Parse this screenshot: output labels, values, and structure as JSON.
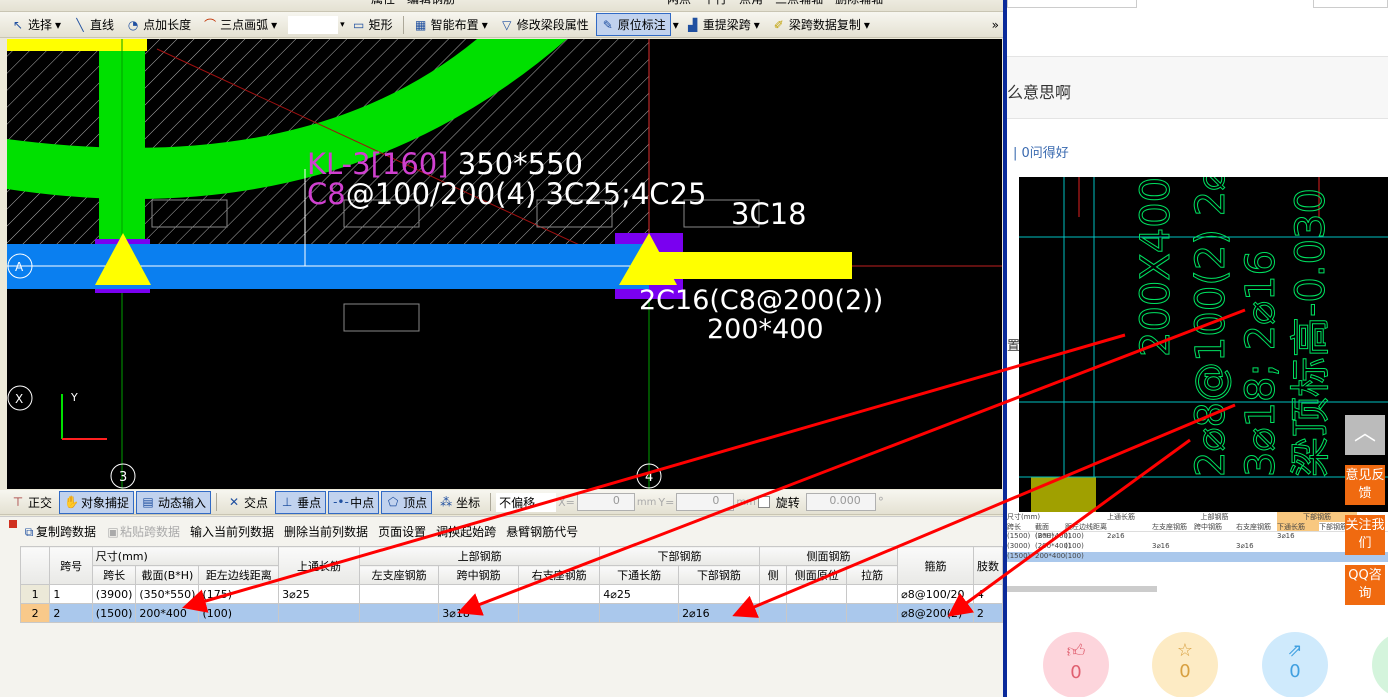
{
  "toolbar_top": {
    "items": [
      "属性",
      "编辑钢筋",
      "两点",
      "平行",
      "点角",
      "三点辅轴",
      "删除辅轴"
    ]
  },
  "toolbar": {
    "select": "选择",
    "line": "直线",
    "point_length": "点加长度",
    "arc": "三点画弧",
    "rect": "矩形",
    "smart": "智能布置",
    "modify_seg": "修改梁段属性",
    "in_situ": "原位标注",
    "repick": "重提梁跨",
    "copy_span": "梁跨数据复制",
    "more": "»"
  },
  "canvas": {
    "label1a": "KL-3[160]",
    "label1b": " 350*550",
    "label2a": "C8",
    "label2b": "@100/200(4) 3C25;4C25",
    "label3": "3C18",
    "label4": "2C16(C8@200(2))",
    "label5": "200*400",
    "axis_a": "A",
    "axis_3": "3",
    "axis_4": "4",
    "axis_x": "X",
    "axis_y": "Y"
  },
  "snapbar": {
    "ortho": "正交",
    "snap": "对象捕捉",
    "dyn": "动态输入",
    "intersect": "交点",
    "perp": "垂点",
    "mid": "中点",
    "vertex": "顶点",
    "coord": "坐标",
    "offset": "不偏移",
    "x_label": "X=",
    "x_val": "0",
    "y_label": "Y=",
    "y_val": "0",
    "mm": "mm",
    "rotate": "旋转",
    "rotate_val": "0.000",
    "deg": "°"
  },
  "panel": {
    "copy": "复制跨数据",
    "paste": "粘贴跨数据",
    "input_col": "输入当前列数据",
    "del_col": "删除当前列数据",
    "page": "页面设置",
    "swap": "调换起始跨",
    "cantilever": "悬臂钢筋代号"
  },
  "table": {
    "h_span": "跨号",
    "h_size": "尺寸(mm)",
    "h_top_through": "上通长筋",
    "h_top": "上部钢筋",
    "h_bottom": "下部钢筋",
    "h_side": "侧面钢筋",
    "h_stirrup": "箍筋",
    "h_legs": "肢数",
    "sub": [
      "跨长",
      "截面(B*H)",
      "距左边线距离",
      "左支座钢筋",
      "跨中钢筋",
      "右支座钢筋",
      "下通长筋",
      "下部钢筋",
      "侧",
      "侧面原位",
      "拉筋"
    ],
    "rows": [
      {
        "n": "1",
        "span": "1",
        "len": "(3900)",
        "sec": "(350*550)",
        "dist": "(175)",
        "top_through": "3⌀25",
        "left": "",
        "mid": "",
        "right": "",
        "bot_through": "4⌀25",
        "bot": "",
        "side": "",
        "side_pos": "",
        "tie": "",
        "stirrup": "⌀8@100/20",
        "legs": "4"
      },
      {
        "n": "2",
        "span": "2",
        "len": "(1500)",
        "sec": "200*400",
        "dist": "(100)",
        "top_through": "",
        "left": "",
        "mid": "3⌀18",
        "right": "",
        "bot_through": "",
        "bot": "2⌀16",
        "side": "",
        "side_pos": "",
        "tie": "",
        "stirrup": "⌀8@200(2)",
        "legs": "2"
      }
    ]
  },
  "web": {
    "question_tail": "么意思啊",
    "good_q": "| 0问得好",
    "side_text": "置",
    "btn_feedback": "意见反馈",
    "btn_follow": "关注我们",
    "btn_qq": "QQ咨询",
    "like": "0",
    "fav": "0",
    "share": "0",
    "img_text1": "200X400",
    "img_text2": "2⌀8@100(2) 2⌀16",
    "img_text3": "3⌀18; 2⌀16",
    "img_text4": "梁顶标高-0.030",
    "mini_headers": [
      "尺寸(mm)",
      "上通长筋",
      "上部钢筋",
      "下部钢筋"
    ],
    "mini_sub": [
      "跨长",
      "截面(B*H)",
      "距左边线距离",
      "左支座钢筋",
      "跨中钢筋",
      "右支座钢筋",
      "下通长筋",
      "下部钢筋"
    ],
    "mini_rows": [
      [
        "(1500)",
        "(200*400)",
        "(100)",
        "2⌀16",
        "",
        "",
        "",
        "3⌀16"
      ],
      [
        "(3000)",
        "(200*400)",
        "(100)",
        "",
        "3⌀16",
        "",
        "3⌀16",
        ""
      ],
      [
        "(1500)",
        "200*400",
        "(100)",
        "",
        "",
        "",
        "",
        ""
      ]
    ]
  },
  "colors": {
    "canvas_bg": "#000000",
    "beam_blue": "#0a7ff0",
    "column_yellow": "#ffff00",
    "green": "#00e000",
    "selected_row": "#aac8ec",
    "orange": "#f06a10",
    "arrow": "#ff0000"
  }
}
